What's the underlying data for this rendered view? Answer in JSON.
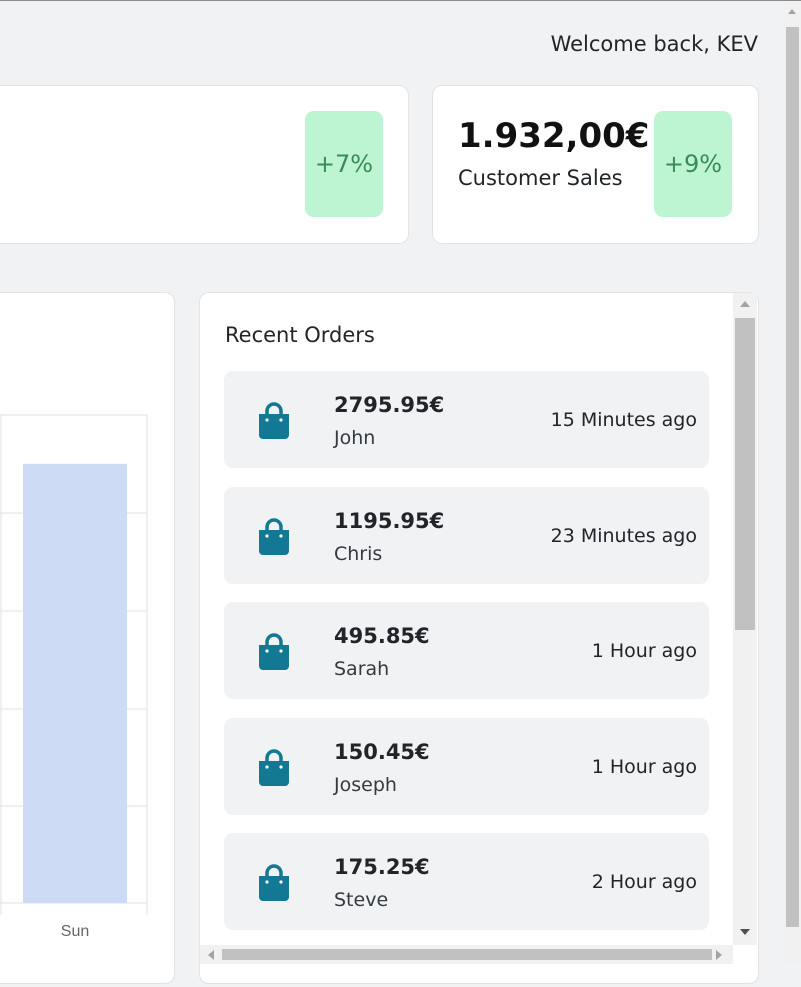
{
  "header": {
    "welcome": "Welcome back, KEV"
  },
  "stats": [
    {
      "value": "",
      "label": "",
      "change": "+7%"
    },
    {
      "value": "1.932,00€",
      "label": "Customer Sales",
      "change": "+9%"
    }
  ],
  "chart_data": {
    "type": "bar",
    "categories": [
      "Sun"
    ],
    "values": [
      0.9
    ],
    "ylim": [
      0,
      1
    ],
    "grid": true,
    "bar_color": "#cddcf4"
  },
  "orders": {
    "title": "Recent Orders",
    "icon": "shopping-bag-icon",
    "icon_color": "#137893",
    "items": [
      {
        "amount": "2795.95€",
        "name": "John",
        "time": "15 Minutes ago"
      },
      {
        "amount": "1195.95€",
        "name": "Chris",
        "time": "23 Minutes ago"
      },
      {
        "amount": "495.85€",
        "name": "Sarah",
        "time": "1 Hour ago"
      },
      {
        "amount": "150.45€",
        "name": "Joseph",
        "time": "1 Hour ago"
      },
      {
        "amount": "175.25€",
        "name": "Steve",
        "time": "2 Hour ago"
      }
    ]
  },
  "colors": {
    "badge_bg": "#bdf5d2",
    "badge_text": "#3a8a5a",
    "page_bg": "#f1f2f4"
  }
}
